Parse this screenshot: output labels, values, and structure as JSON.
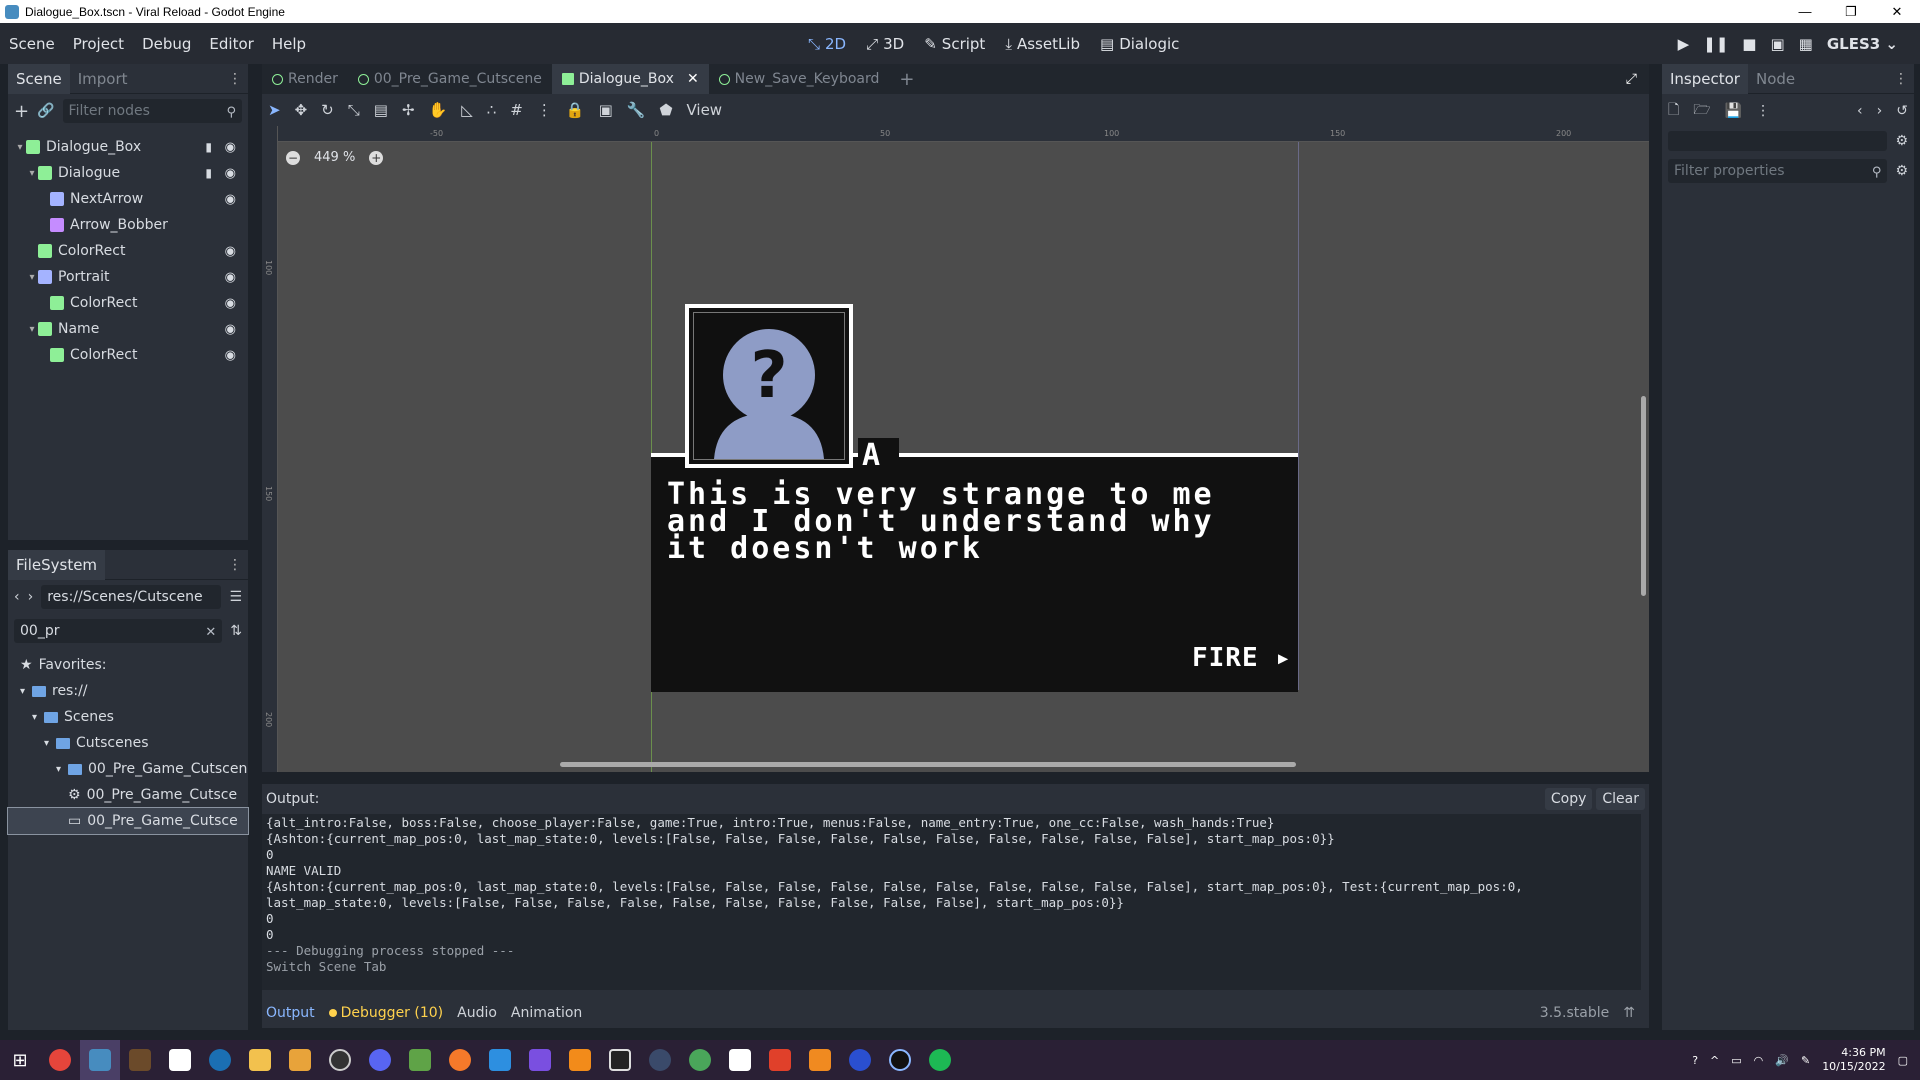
{
  "title": "Dialogue_Box.tscn - Viral Reload - Godot Engine",
  "menus": [
    "Scene",
    "Project",
    "Debug",
    "Editor",
    "Help"
  ],
  "main_screens": [
    {
      "label": "2D",
      "icon": "2d-icon",
      "active": true
    },
    {
      "label": "3D",
      "icon": "3d-icon"
    },
    {
      "label": "Script",
      "icon": "script-icon"
    },
    {
      "label": "AssetLib",
      "icon": "assetlib-icon"
    },
    {
      "label": "Dialogic",
      "icon": "dialogic-icon"
    }
  ],
  "renderer": "GLES3",
  "scene_dock": {
    "tabs": [
      "Scene",
      "Import"
    ],
    "filter_placeholder": "Filter nodes",
    "nodes": [
      {
        "label": "Dialogue_Box",
        "depth": 0,
        "icon": "control",
        "arrow": "▾",
        "script": true,
        "eye": true
      },
      {
        "label": "Dialogue",
        "depth": 1,
        "icon": "control",
        "arrow": "▾",
        "script": true,
        "eye": true
      },
      {
        "label": "NextArrow",
        "depth": 2,
        "icon": "sprite",
        "arrow": "",
        "script": false,
        "eye": true
      },
      {
        "label": "Arrow_Bobber",
        "depth": 2,
        "icon": "anim",
        "arrow": "",
        "script": false,
        "eye": false
      },
      {
        "label": "ColorRect",
        "depth": 1,
        "icon": "control",
        "arrow": "",
        "script": false,
        "eye": true
      },
      {
        "label": "Portrait",
        "depth": 1,
        "icon": "sprite",
        "arrow": "▾",
        "script": false,
        "eye": true
      },
      {
        "label": "ColorRect",
        "depth": 2,
        "icon": "control",
        "arrow": "",
        "script": false,
        "eye": true
      },
      {
        "label": "Name",
        "depth": 1,
        "icon": "control",
        "arrow": "▾",
        "script": false,
        "eye": true
      },
      {
        "label": "ColorRect",
        "depth": 2,
        "icon": "control",
        "arrow": "",
        "script": false,
        "eye": true
      }
    ]
  },
  "filesystem": {
    "tab": "FileSystem",
    "path": "res://Scenes/Cutscene",
    "search": "00_pr",
    "items": [
      {
        "label": "Favorites:",
        "depth": 0,
        "type": "star"
      },
      {
        "label": "res://",
        "depth": 0,
        "type": "folder"
      },
      {
        "label": "Scenes",
        "depth": 1,
        "type": "folder"
      },
      {
        "label": "Cutscenes",
        "depth": 2,
        "type": "folder"
      },
      {
        "label": "00_Pre_Game_Cutscen",
        "depth": 3,
        "type": "folder"
      },
      {
        "label": "00_Pre_Game_Cutsce",
        "depth": 4,
        "type": "gear"
      },
      {
        "label": "00_Pre_Game_Cutsce",
        "depth": 4,
        "type": "scene",
        "selected": true
      }
    ]
  },
  "editor_tabs": [
    {
      "label": "Render",
      "active": false
    },
    {
      "label": "00_Pre_Game_Cutscene",
      "active": false
    },
    {
      "label": "Dialogue_Box",
      "active": true
    },
    {
      "label": "New_Save_Keyboard",
      "active": false
    }
  ],
  "view_menu": "View",
  "zoom": "449 %",
  "rulers": {
    "top": [
      "-50",
      "0",
      "50",
      "100",
      "150",
      "200"
    ],
    "left": [
      "100",
      "150",
      "200"
    ]
  },
  "dialog": {
    "name_letter": "A",
    "text": "This is very strange to me and I don't understand why it doesn't work",
    "button": "FIRE"
  },
  "output": {
    "label": "Output:",
    "copy": "Copy",
    "clear": "Clear",
    "lines": [
      "{alt_intro:False, boss:False, choose_player:False, game:True, intro:True, menus:False, name_entry:True, one_cc:False, wash_hands:True}",
      "{Ashton:{current_map_pos:0, last_map_state:0, levels:[False, False, False, False, False, False, False, False, False, False], start_map_pos:0}}",
      "0",
      "NAME VALID",
      "{Ashton:{current_map_pos:0, last_map_state:0, levels:[False, False, False, False, False, False, False, False, False, False], start_map_pos:0}, Test:{current_map_pos:0,",
      "last_map_state:0, levels:[False, False, False, False, False, False, False, False, False, False], start_map_pos:0}}",
      "0",
      "0"
    ],
    "dim_lines": [
      "--- Debugging process stopped ---",
      "Switch Scene Tab"
    ]
  },
  "bottom_tabs": [
    "Output",
    "Debugger (10)",
    "Audio",
    "Animation"
  ],
  "version": "3.5.stable",
  "inspector": {
    "tabs": [
      "Inspector",
      "Node"
    ],
    "filter_placeholder": "Filter properties"
  },
  "clock": {
    "time": "4:36 PM",
    "date": "10/15/2022"
  }
}
